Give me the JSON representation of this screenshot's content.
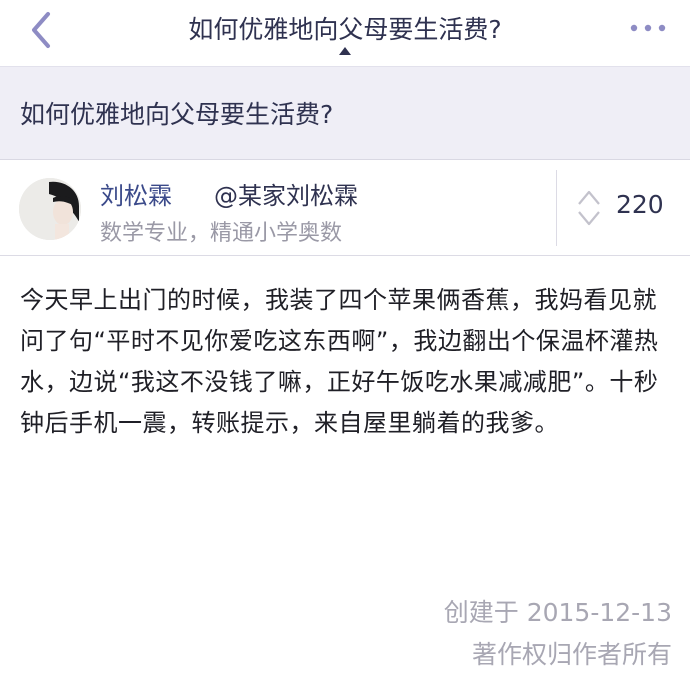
{
  "nav": {
    "title": "如何优雅地向父母要生活费?",
    "back_icon": "chevron-left-icon",
    "more_icon": "more-dots-icon",
    "accent": "#8e8cc4"
  },
  "question": {
    "title": "如何优雅地向父母要生活费?"
  },
  "answer": {
    "author_name": "刘松霖",
    "author_handle": "@某家刘松霖",
    "author_bio": "数学专业，精通小学奥数",
    "vote_count": "220",
    "body": "今天早上出门的时候，我装了四个苹果俩香蕉，我妈看见就问了句“平时不见你爱吃这东西啊”，我边翻出个保温杯灌热水，边说“我这不没钱了嘛，正好午饭吃水果减减肥”。十秒钟后手机一震，转账提示，来自屋里躺着的我爹。",
    "created_label": "创建于 2015-12-13",
    "copyright": "著作权归作者所有"
  },
  "colors": {
    "author_name": "#3b4a8a",
    "header_bg": "#efeef6",
    "meta_text": "#a8a7b3"
  }
}
